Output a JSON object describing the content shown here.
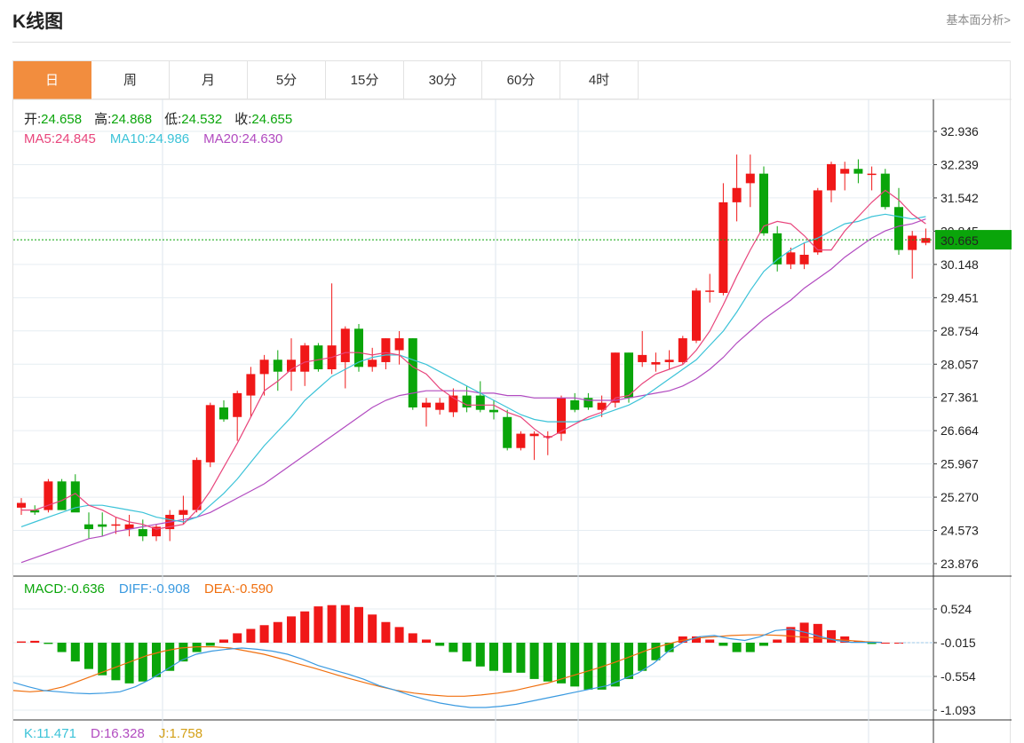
{
  "header": {
    "title": "K线图",
    "more_link": "基本面分析>"
  },
  "tabs": [
    {
      "label": "日",
      "active": true
    },
    {
      "label": "周",
      "active": false
    },
    {
      "label": "月",
      "active": false
    },
    {
      "label": "5分",
      "active": false
    },
    {
      "label": "15分",
      "active": false
    },
    {
      "label": "30分",
      "active": false
    },
    {
      "label": "60分",
      "active": false
    },
    {
      "label": "4时",
      "active": false
    }
  ],
  "ohlc_info": {
    "open_label": "开:",
    "open_value": "24.658",
    "high_label": "高:",
    "high_value": "24.868",
    "low_label": "低:",
    "low_value": "24.532",
    "close_label": "收:",
    "close_value": "24.655"
  },
  "ma_info": {
    "ma5_label": "MA5:",
    "ma5_value": "24.845",
    "ma10_label": "MA10:",
    "ma10_value": "24.986",
    "ma20_label": "MA20:",
    "ma20_value": "24.630"
  },
  "macd_info": {
    "macd_label": "MACD:",
    "macd_value": "-0.636",
    "diff_label": "DIFF:",
    "diff_value": "-0.908",
    "dea_label": "DEA:",
    "dea_value": "-0.590"
  },
  "kdj_info": {
    "k_label": "K:",
    "k_value": "11.471",
    "d_label": "D:",
    "d_value": "16.328",
    "j_label": "J:",
    "j_value": "1.758"
  },
  "colors": {
    "up": "#f01818",
    "down": "#0aa50a",
    "ma5": "#e8457c",
    "ma10": "#3cc3d8",
    "ma20": "#b24bc0",
    "diff": "#3a9ae0",
    "dea": "#f07010",
    "price_tag": "#0aa50a",
    "accent": "#f28d3e"
  },
  "chart_data": {
    "type": "candlestick",
    "price_axis_ticks": [
      "32.936",
      "32.239",
      "31.542",
      "30.845",
      "30.148",
      "29.451",
      "28.754",
      "28.057",
      "27.361",
      "26.664",
      "25.967",
      "25.270",
      "24.573",
      "23.876"
    ],
    "price_ylim": [
      23.876,
      32.936
    ],
    "current_price": "30.665",
    "macd_axis_ticks": [
      "0.524",
      "-0.015",
      "-0.554",
      "-1.093"
    ],
    "macd_ylim": [
      -1.093,
      0.524
    ],
    "candles": [
      {
        "o": 25.05,
        "h": 25.25,
        "l": 24.9,
        "c": 25.15
      },
      {
        "o": 25.0,
        "h": 25.1,
        "l": 24.9,
        "c": 24.95
      },
      {
        "o": 25.0,
        "h": 25.65,
        "l": 24.95,
        "c": 25.6
      },
      {
        "o": 25.6,
        "h": 25.65,
        "l": 25.0,
        "c": 25.0
      },
      {
        "o": 25.6,
        "h": 25.75,
        "l": 25.0,
        "c": 24.95
      },
      {
        "o": 24.7,
        "h": 24.95,
        "l": 24.4,
        "c": 24.6
      },
      {
        "o": 24.7,
        "h": 24.95,
        "l": 24.45,
        "c": 24.65
      },
      {
        "o": 24.7,
        "h": 24.85,
        "l": 24.5,
        "c": 24.7
      },
      {
        "o": 24.6,
        "h": 24.9,
        "l": 24.45,
        "c": 24.7
      },
      {
        "o": 24.6,
        "h": 24.8,
        "l": 24.35,
        "c": 24.45
      },
      {
        "o": 24.45,
        "h": 24.7,
        "l": 24.35,
        "c": 24.65
      },
      {
        "o": 24.6,
        "h": 25.0,
        "l": 24.35,
        "c": 24.9
      },
      {
        "o": 24.9,
        "h": 25.3,
        "l": 24.7,
        "c": 25.0
      },
      {
        "o": 25.0,
        "h": 26.1,
        "l": 24.95,
        "c": 26.05
      },
      {
        "o": 26.0,
        "h": 27.25,
        "l": 25.9,
        "c": 27.2
      },
      {
        "o": 27.15,
        "h": 27.3,
        "l": 26.85,
        "c": 26.9
      },
      {
        "o": 26.95,
        "h": 27.5,
        "l": 26.45,
        "c": 27.45
      },
      {
        "o": 27.4,
        "h": 28.0,
        "l": 26.95,
        "c": 27.85
      },
      {
        "o": 27.85,
        "h": 28.25,
        "l": 27.4,
        "c": 28.15
      },
      {
        "o": 28.15,
        "h": 28.35,
        "l": 27.5,
        "c": 27.9
      },
      {
        "o": 27.9,
        "h": 28.6,
        "l": 27.5,
        "c": 28.15
      },
      {
        "o": 27.9,
        "h": 28.5,
        "l": 27.6,
        "c": 28.45
      },
      {
        "o": 28.45,
        "h": 28.5,
        "l": 27.9,
        "c": 27.95
      },
      {
        "o": 27.95,
        "h": 29.75,
        "l": 27.85,
        "c": 28.45
      },
      {
        "o": 28.1,
        "h": 28.85,
        "l": 27.55,
        "c": 28.8
      },
      {
        "o": 28.8,
        "h": 28.9,
        "l": 27.9,
        "c": 28.0
      },
      {
        "o": 28.0,
        "h": 28.4,
        "l": 27.9,
        "c": 28.15
      },
      {
        "o": 28.1,
        "h": 28.6,
        "l": 27.95,
        "c": 28.6
      },
      {
        "o": 28.35,
        "h": 28.75,
        "l": 28.05,
        "c": 28.6
      },
      {
        "o": 28.6,
        "h": 28.6,
        "l": 27.1,
        "c": 27.15
      },
      {
        "o": 27.15,
        "h": 27.35,
        "l": 26.75,
        "c": 27.25
      },
      {
        "o": 27.1,
        "h": 27.35,
        "l": 27.0,
        "c": 27.25
      },
      {
        "o": 27.05,
        "h": 27.55,
        "l": 26.95,
        "c": 27.4
      },
      {
        "o": 27.4,
        "h": 27.6,
        "l": 27.05,
        "c": 27.15
      },
      {
        "o": 27.4,
        "h": 27.7,
        "l": 27.05,
        "c": 27.1
      },
      {
        "o": 27.1,
        "h": 27.3,
        "l": 26.9,
        "c": 27.05
      },
      {
        "o": 26.95,
        "h": 27.1,
        "l": 26.25,
        "c": 26.3
      },
      {
        "o": 26.3,
        "h": 26.65,
        "l": 26.25,
        "c": 26.6
      },
      {
        "o": 26.55,
        "h": 26.65,
        "l": 26.05,
        "c": 26.6
      },
      {
        "o": 26.55,
        "h": 26.65,
        "l": 26.15,
        "c": 26.55
      },
      {
        "o": 26.6,
        "h": 27.4,
        "l": 26.45,
        "c": 27.35
      },
      {
        "o": 27.3,
        "h": 27.45,
        "l": 27.05,
        "c": 27.1
      },
      {
        "o": 27.35,
        "h": 27.45,
        "l": 27.1,
        "c": 27.15
      },
      {
        "o": 27.1,
        "h": 27.4,
        "l": 26.95,
        "c": 27.25
      },
      {
        "o": 27.25,
        "h": 28.3,
        "l": 27.15,
        "c": 28.3
      },
      {
        "o": 28.3,
        "h": 28.3,
        "l": 27.25,
        "c": 27.35
      },
      {
        "o": 28.1,
        "h": 28.75,
        "l": 28.0,
        "c": 28.25
      },
      {
        "o": 28.05,
        "h": 28.3,
        "l": 27.9,
        "c": 28.1
      },
      {
        "o": 28.1,
        "h": 28.35,
        "l": 27.95,
        "c": 28.15
      },
      {
        "o": 28.1,
        "h": 28.65,
        "l": 28.05,
        "c": 28.6
      },
      {
        "o": 28.55,
        "h": 29.65,
        "l": 28.5,
        "c": 29.6
      },
      {
        "o": 29.6,
        "h": 29.95,
        "l": 29.35,
        "c": 29.6
      },
      {
        "o": 29.55,
        "h": 31.85,
        "l": 29.5,
        "c": 31.45
      },
      {
        "o": 31.45,
        "h": 32.45,
        "l": 31.05,
        "c": 31.75
      },
      {
        "o": 31.85,
        "h": 32.45,
        "l": 31.35,
        "c": 32.05
      },
      {
        "o": 32.05,
        "h": 32.2,
        "l": 30.75,
        "c": 30.8
      },
      {
        "o": 30.8,
        "h": 30.95,
        "l": 30.0,
        "c": 30.15
      },
      {
        "o": 30.15,
        "h": 30.5,
        "l": 30.05,
        "c": 30.4
      },
      {
        "o": 30.15,
        "h": 30.6,
        "l": 30.05,
        "c": 30.35
      },
      {
        "o": 30.4,
        "h": 31.75,
        "l": 30.35,
        "c": 31.7
      },
      {
        "o": 31.7,
        "h": 32.3,
        "l": 31.45,
        "c": 32.25
      },
      {
        "o": 32.05,
        "h": 32.3,
        "l": 31.7,
        "c": 32.15
      },
      {
        "o": 32.15,
        "h": 32.35,
        "l": 31.85,
        "c": 32.05
      },
      {
        "o": 32.05,
        "h": 32.2,
        "l": 31.7,
        "c": 32.05
      },
      {
        "o": 32.05,
        "h": 32.15,
        "l": 31.3,
        "c": 31.35
      },
      {
        "o": 31.35,
        "h": 31.75,
        "l": 30.35,
        "c": 30.45
      },
      {
        "o": 30.45,
        "h": 30.85,
        "l": 29.85,
        "c": 30.75
      },
      {
        "o": 30.6,
        "h": 30.9,
        "l": 30.55,
        "c": 30.7
      }
    ],
    "ma5": [
      25.0,
      25.0,
      25.1,
      25.2,
      25.35,
      25.1,
      25.0,
      24.85,
      24.75,
      24.7,
      24.6,
      24.65,
      24.7,
      25.0,
      25.4,
      25.9,
      26.4,
      26.95,
      27.5,
      27.7,
      27.95,
      28.1,
      28.15,
      28.2,
      28.3,
      28.3,
      28.25,
      28.3,
      28.25,
      28.0,
      27.85,
      27.55,
      27.35,
      27.2,
      27.2,
      27.2,
      27.05,
      26.95,
      26.7,
      26.5,
      26.65,
      26.8,
      26.95,
      27.05,
      27.35,
      27.4,
      27.65,
      27.85,
      27.95,
      28.05,
      28.35,
      28.75,
      29.3,
      29.9,
      30.45,
      30.95,
      31.05,
      31.0,
      30.75,
      30.45,
      30.45,
      30.85,
      31.15,
      31.45,
      31.7,
      31.5,
      31.2,
      31.0
    ],
    "ma10": [
      24.65,
      24.75,
      24.85,
      24.95,
      25.05,
      25.1,
      25.1,
      25.05,
      25.0,
      24.95,
      24.85,
      24.8,
      24.75,
      24.85,
      25.1,
      25.35,
      25.65,
      26.0,
      26.35,
      26.65,
      26.95,
      27.3,
      27.55,
      27.8,
      27.95,
      28.1,
      28.2,
      28.25,
      28.25,
      28.15,
      28.05,
      27.9,
      27.75,
      27.6,
      27.45,
      27.3,
      27.15,
      27.0,
      26.9,
      26.85,
      26.85,
      26.85,
      26.9,
      27.0,
      27.1,
      27.2,
      27.35,
      27.55,
      27.75,
      27.95,
      28.15,
      28.45,
      28.75,
      29.15,
      29.6,
      30.0,
      30.25,
      30.45,
      30.6,
      30.7,
      30.85,
      31.0,
      31.05,
      31.15,
      31.2,
      31.15,
      31.1,
      31.15
    ],
    "ma20": [
      23.9,
      24.0,
      24.1,
      24.2,
      24.3,
      24.4,
      24.45,
      24.55,
      24.6,
      24.65,
      24.7,
      24.75,
      24.8,
      24.85,
      24.95,
      25.1,
      25.25,
      25.4,
      25.55,
      25.75,
      25.95,
      26.15,
      26.35,
      26.55,
      26.75,
      26.95,
      27.15,
      27.3,
      27.4,
      27.45,
      27.5,
      27.5,
      27.5,
      27.5,
      27.45,
      27.45,
      27.4,
      27.4,
      27.35,
      27.35,
      27.35,
      27.35,
      27.3,
      27.3,
      27.3,
      27.35,
      27.4,
      27.45,
      27.5,
      27.6,
      27.75,
      27.95,
      28.2,
      28.5,
      28.75,
      29.0,
      29.2,
      29.4,
      29.65,
      29.85,
      30.05,
      30.3,
      30.5,
      30.7,
      30.85,
      30.95,
      31.0,
      31.1
    ],
    "macd_hist": [
      0.02,
      0.03,
      -0.02,
      -0.15,
      -0.3,
      -0.42,
      -0.52,
      -0.6,
      -0.65,
      -0.62,
      -0.55,
      -0.45,
      -0.3,
      -0.15,
      -0.05,
      0.05,
      0.15,
      0.22,
      0.28,
      0.33,
      0.42,
      0.5,
      0.58,
      0.6,
      0.6,
      0.57,
      0.45,
      0.33,
      0.25,
      0.15,
      0.05,
      -0.05,
      -0.15,
      -0.3,
      -0.38,
      -0.45,
      -0.48,
      -0.48,
      -0.58,
      -0.62,
      -0.65,
      -0.7,
      -0.75,
      -0.75,
      -0.7,
      -0.58,
      -0.45,
      -0.28,
      -0.15,
      0.1,
      0.1,
      0.05,
      -0.05,
      -0.15,
      -0.15,
      -0.05,
      0.05,
      0.25,
      0.32,
      0.3,
      0.2,
      0.1,
      0.03,
      -0.02,
      0.0,
      0.0
    ],
    "macd_diff": [
      -0.65,
      -0.72,
      -0.78,
      -0.8,
      -0.82,
      -0.83,
      -0.82,
      -0.8,
      -0.72,
      -0.6,
      -0.45,
      -0.3,
      -0.2,
      -0.15,
      -0.12,
      -0.1,
      -0.12,
      -0.15,
      -0.2,
      -0.28,
      -0.38,
      -0.45,
      -0.52,
      -0.6,
      -0.7,
      -0.77,
      -0.85,
      -0.92,
      -0.98,
      -1.02,
      -1.05,
      -1.05,
      -1.03,
      -1.0,
      -0.95,
      -0.9,
      -0.85,
      -0.8,
      -0.75,
      -0.7,
      -0.6,
      -0.5,
      -0.35,
      -0.15,
      0.0,
      0.08,
      0.1,
      0.05,
      0.02,
      0.08,
      0.18,
      0.2,
      0.15,
      0.08,
      0.02,
      -0.01,
      -0.01,
      -0.01
    ],
    "macd_dea": [
      -0.78,
      -0.8,
      -0.78,
      -0.72,
      -0.62,
      -0.52,
      -0.42,
      -0.32,
      -0.22,
      -0.15,
      -0.1,
      -0.08,
      -0.08,
      -0.1,
      -0.15,
      -0.2,
      -0.27,
      -0.35,
      -0.42,
      -0.5,
      -0.58,
      -0.65,
      -0.72,
      -0.78,
      -0.82,
      -0.85,
      -0.87,
      -0.87,
      -0.85,
      -0.82,
      -0.78,
      -0.72,
      -0.66,
      -0.58,
      -0.5,
      -0.42,
      -0.33,
      -0.23,
      -0.13,
      -0.05,
      0.02,
      0.06,
      0.08,
      0.1,
      0.11,
      0.11,
      0.1,
      0.08,
      0.06,
      0.04,
      0.02,
      0.0,
      -0.01
    ]
  }
}
